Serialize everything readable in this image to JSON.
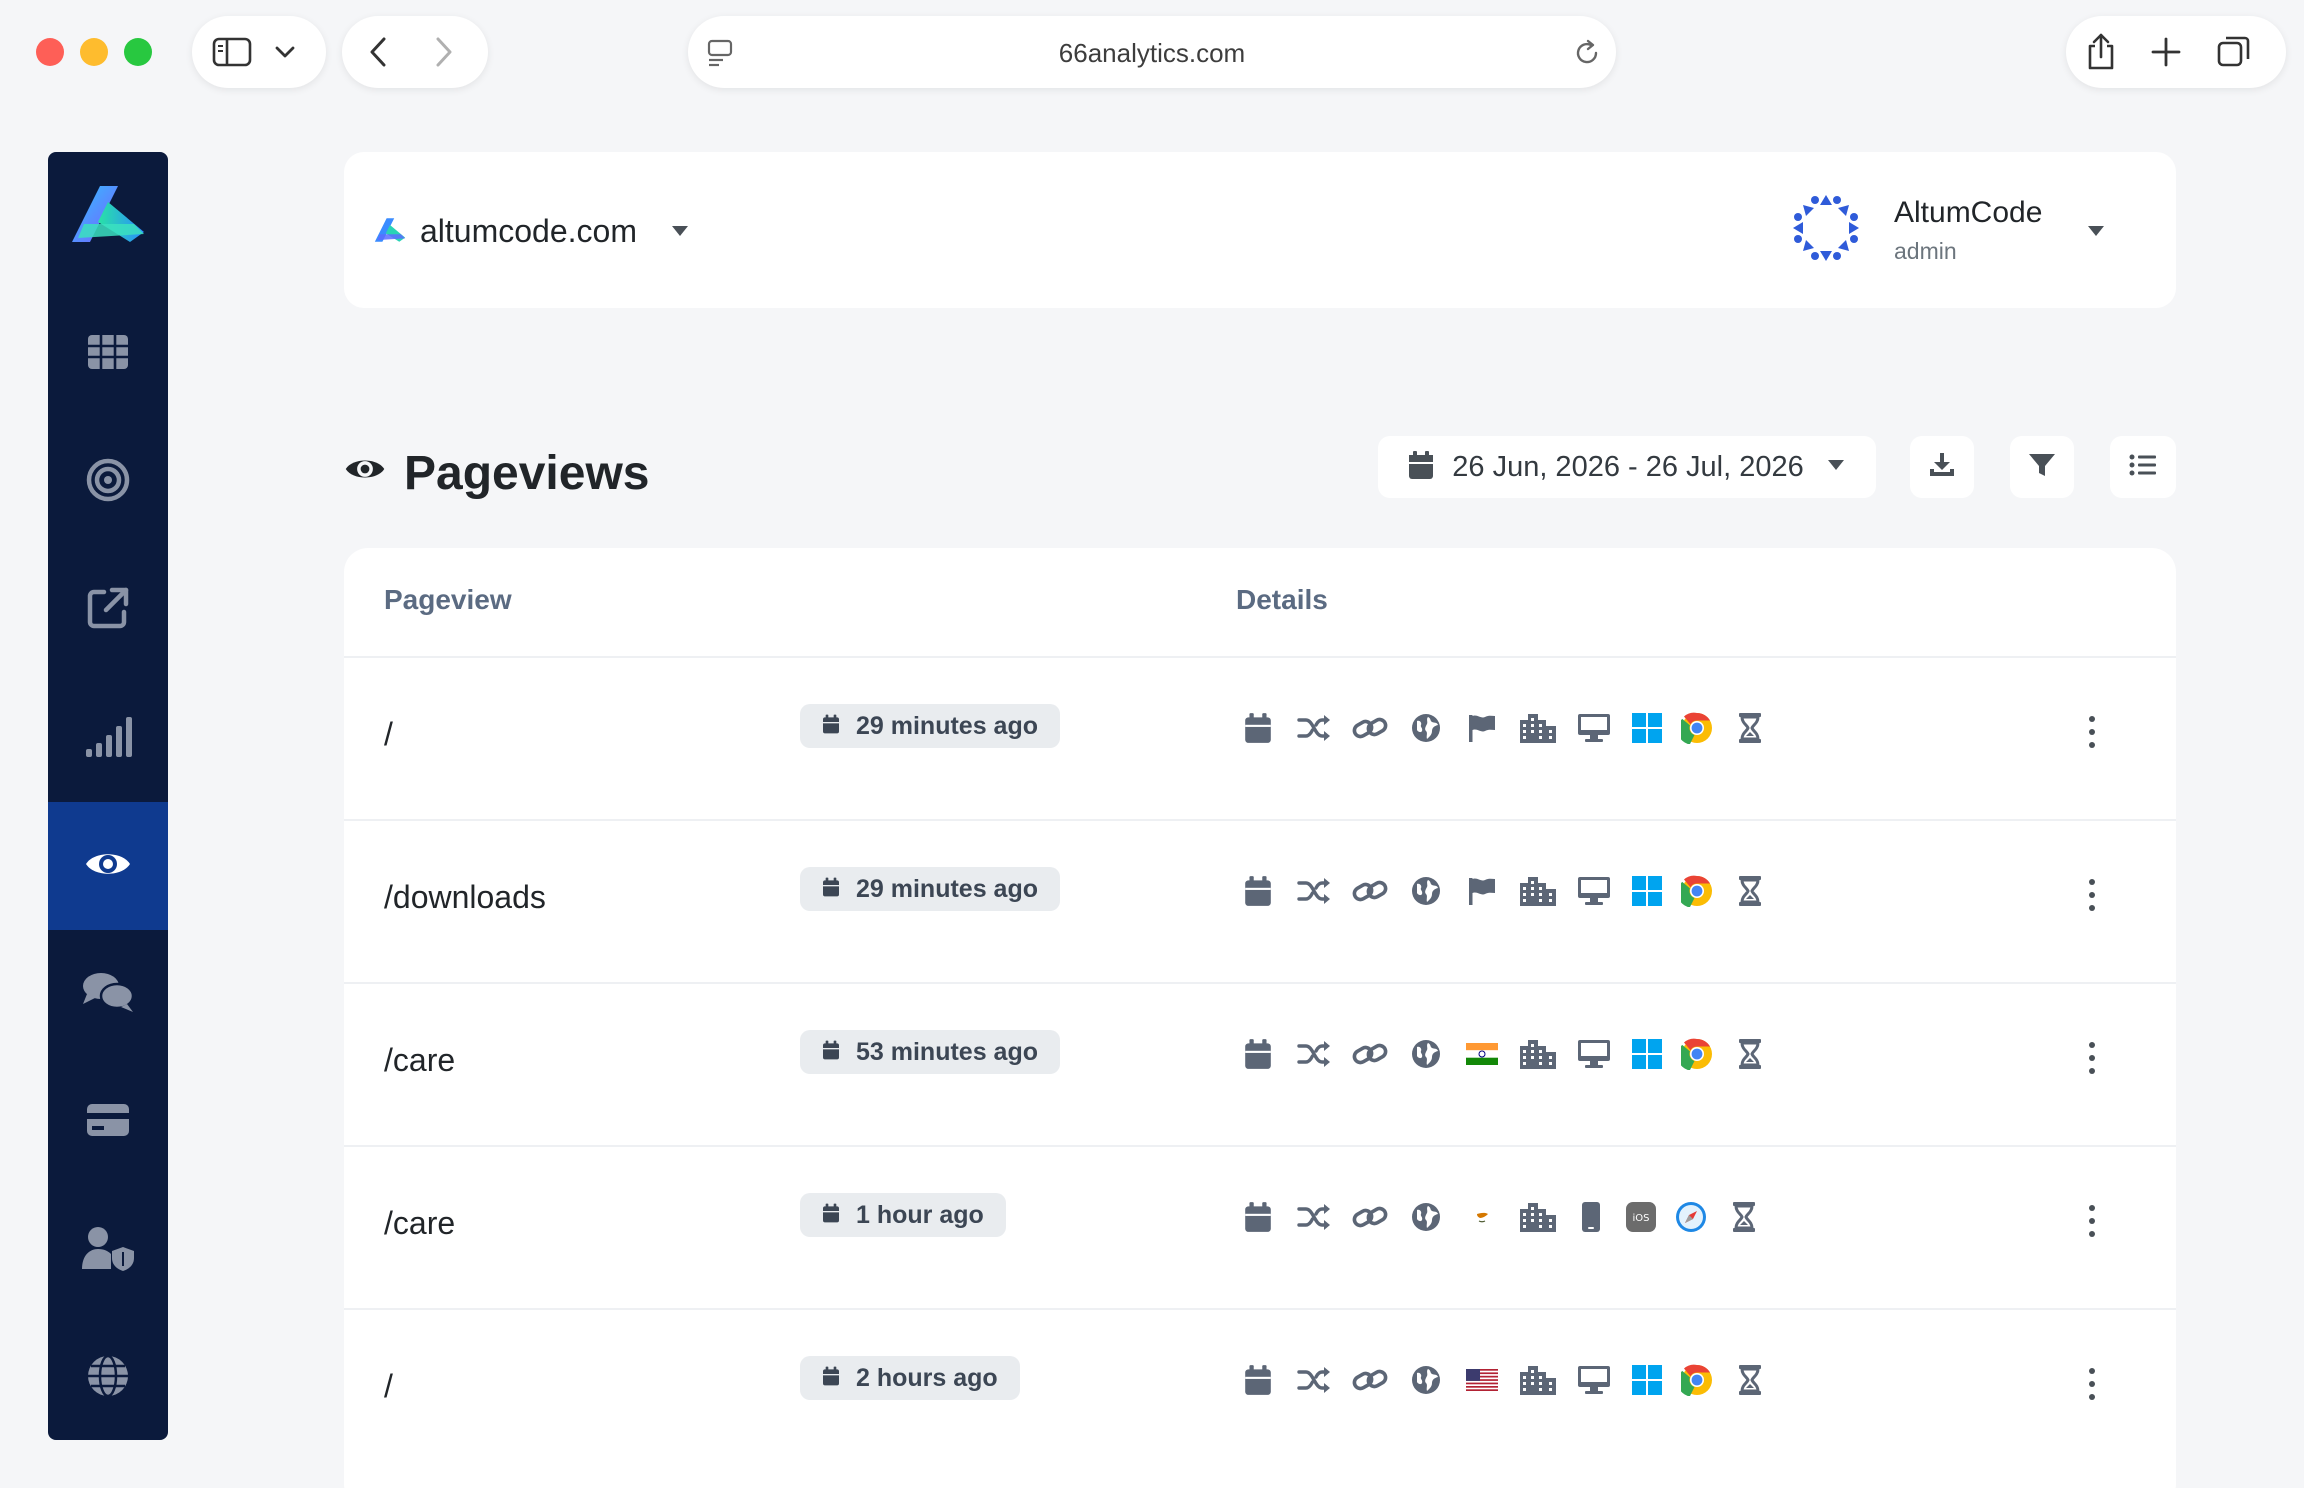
{
  "browser": {
    "url": "66analytics.com"
  },
  "sidebar": {
    "items": [
      {
        "name": "dashboard",
        "icon": "grid-icon",
        "active": false
      },
      {
        "name": "goals",
        "icon": "target-icon",
        "active": false
      },
      {
        "name": "referrers",
        "icon": "external-link-icon",
        "active": false
      },
      {
        "name": "stats",
        "icon": "signal-bars-icon",
        "active": false
      },
      {
        "name": "pageviews",
        "icon": "eye-icon",
        "active": true
      },
      {
        "name": "messages",
        "icon": "comments-icon",
        "active": false
      },
      {
        "name": "billing",
        "icon": "card-icon",
        "active": false
      },
      {
        "name": "team",
        "icon": "user-shield-icon",
        "active": false
      },
      {
        "name": "websites",
        "icon": "globe-icon",
        "active": false
      }
    ]
  },
  "header": {
    "site_name": "altumcode.com",
    "user_name": "AltumCode",
    "user_role": "admin"
  },
  "page": {
    "title": "Pageviews",
    "date_range": "26 Jun, 2026 - 26 Jul, 2026"
  },
  "table": {
    "columns": [
      "Pageview",
      "Details"
    ],
    "rows": [
      {
        "path": "/",
        "time": "29 minutes ago",
        "country_flag": "flag-icon",
        "device": "desktop-icon",
        "os": "windows-icon",
        "browser": "chrome-icon"
      },
      {
        "path": "/downloads",
        "time": "29 minutes ago",
        "country_flag": "flag-icon",
        "device": "desktop-icon",
        "os": "windows-icon",
        "browser": "chrome-icon"
      },
      {
        "path": "/care",
        "time": "53 minutes ago",
        "country_flag": "india-flag-icon",
        "device": "desktop-icon",
        "os": "windows-icon",
        "browser": "chrome-icon"
      },
      {
        "path": "/care",
        "time": "1 hour ago",
        "country_flag": "cyprus-flag-icon",
        "device": "mobile-icon",
        "os": "ios-icon",
        "browser": "safari-icon"
      },
      {
        "path": "/",
        "time": "2 hours ago",
        "country_flag": "usa-flag-icon",
        "device": "desktop-icon",
        "os": "windows-icon",
        "browser": "chrome-icon"
      }
    ]
  },
  "colors": {
    "sidebar_bg": "#0b1a3c",
    "sidebar_active": "#0f3a8f",
    "page_bg": "#f5f6f8",
    "badge_bg": "#e9ecef"
  }
}
